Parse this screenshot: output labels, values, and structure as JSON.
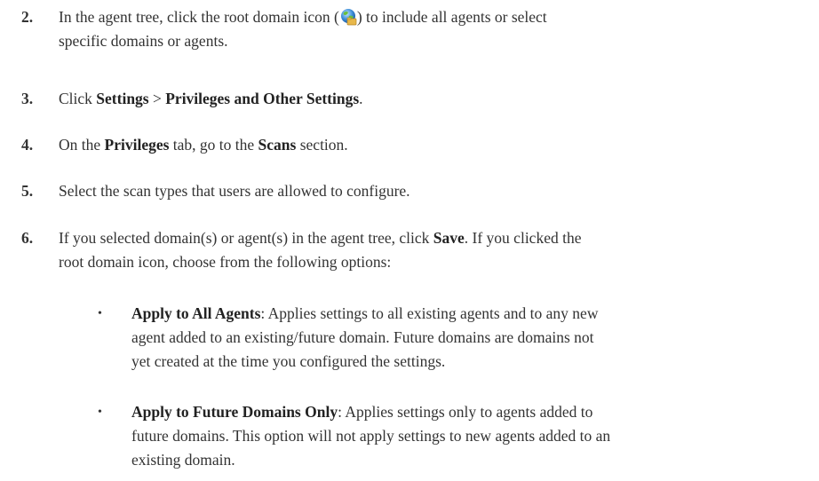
{
  "steps": [
    {
      "num": "2.",
      "text_a": "In the agent tree, click the root domain icon (",
      "icon": "globe-folder-icon",
      "text_b": ") to include all agents or select",
      "text_c": "specific domains or agents."
    },
    {
      "num": "3.",
      "pre": "Click ",
      "b1": "Settings",
      "mid": " > ",
      "b2": "Privileges and Other Settings",
      "post": "."
    },
    {
      "num": "4.",
      "pre": "On the ",
      "b1": "Privileges",
      "mid": " tab, go to the ",
      "b2": "Scans",
      "post": " section."
    },
    {
      "num": "5.",
      "text": "Select the scan types that users are allowed to configure."
    },
    {
      "num": "6.",
      "pre": "If you selected domain(s) or agent(s) in the agent tree, click ",
      "b1": "Save",
      "post": ". If you clicked the",
      "line2": "root domain icon, choose from the following options:"
    }
  ],
  "bullets": [
    {
      "mark": "•",
      "title": "Apply to All Agents",
      "line1": ": Applies settings to all existing agents and to any new",
      "line2": "agent added to an existing/future domain. Future domains are domains not",
      "line3": "yet created at the time you configured the settings."
    },
    {
      "mark": "•",
      "title": "Apply to Future Domains Only",
      "line1": ": Applies settings only to agents added to",
      "line2": "future domains. This option will not apply settings to new agents added to an",
      "line3": "existing domain."
    }
  ]
}
